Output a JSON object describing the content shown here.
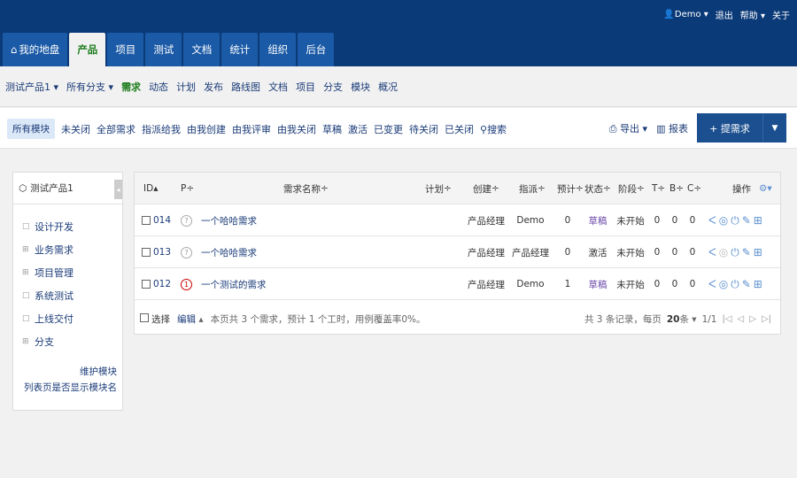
{
  "header": {
    "user": "Demo",
    "logout": "退出",
    "help": "帮助",
    "about": "关于",
    "tabs": [
      {
        "label": "我的地盘",
        "icon": "home-icon"
      },
      {
        "label": "产品"
      },
      {
        "label": "项目"
      },
      {
        "label": "测试"
      },
      {
        "label": "文档"
      },
      {
        "label": "统计"
      },
      {
        "label": "组织"
      },
      {
        "label": "后台"
      }
    ]
  },
  "subnav": {
    "product": "测试产品1",
    "branch": "所有分支",
    "items": [
      "需求",
      "动态",
      "计划",
      "发布",
      "路线图",
      "文档",
      "项目",
      "分支",
      "模块",
      "概况"
    ]
  },
  "filterbar": {
    "module": "所有模块",
    "filters": [
      "未关闭",
      "全部需求",
      "指派给我",
      "由我创建",
      "由我评审",
      "由我关闭",
      "草稿",
      "激活",
      "已变更",
      "待关闭",
      "已关闭"
    ],
    "search": "搜索",
    "export": "导出",
    "report": "报表",
    "create": "+ 提需求"
  },
  "sidebar": {
    "title": "测试产品1",
    "modules": [
      {
        "bullet": "□",
        "label": "设计开发"
      },
      {
        "bullet": "⊞",
        "label": "业务需求"
      },
      {
        "bullet": "⊞",
        "label": "项目管理"
      },
      {
        "bullet": "□",
        "label": "系统测试"
      },
      {
        "bullet": "□",
        "label": "上线交付"
      },
      {
        "bullet": "⊞",
        "label": "分支"
      }
    ],
    "maintain": "维护模块",
    "show_module": "列表页是否显示模块名"
  },
  "table": {
    "headers": {
      "id": "ID",
      "pri": "P",
      "name": "需求名称",
      "plan": "计划",
      "creator": "创建",
      "assigned": "指派",
      "estimate": "预计",
      "status": "状态",
      "stage": "阶段",
      "t": "T",
      "b": "B",
      "c": "C",
      "ops": "操作"
    },
    "rows": [
      {
        "id": "014",
        "pri": "?",
        "name": "一个哈哈需求",
        "plan": "",
        "creator": "产品经理",
        "assigned": "Demo",
        "estimate": "0",
        "status": "草稿",
        "stage": "未开始",
        "t": "0",
        "b": "0",
        "c": "0"
      },
      {
        "id": "013",
        "pri": "?",
        "name": "一个哈哈需求",
        "plan": "",
        "creator": "产品经理",
        "assigned": "产品经理",
        "estimate": "0",
        "status": "激活",
        "stage": "未开始",
        "t": "0",
        "b": "0",
        "c": "0"
      },
      {
        "id": "012",
        "pri": "1",
        "name": "一个测试的需求",
        "plan": "",
        "creator": "产品经理",
        "assigned": "Demo",
        "estimate": "1",
        "status": "草稿",
        "stage": "未开始",
        "t": "0",
        "b": "0",
        "c": "0"
      }
    ],
    "footer": {
      "select": "选择",
      "edit": "编辑",
      "summary": "本页共 3 个需求，预计 1 个工时，用例覆盖率0%。",
      "records": "共 3 条记录，每页",
      "per_page": "20",
      "per_page_unit": "条",
      "page": "1/1"
    }
  }
}
